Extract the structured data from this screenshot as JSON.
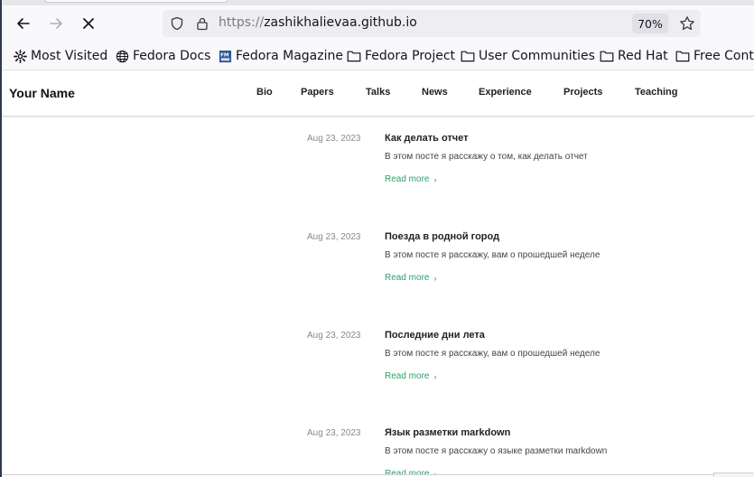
{
  "browser": {
    "url_scheme": "https://",
    "url_host": "zashikhalievaa.github.io",
    "zoom": "70%",
    "icons": [
      "back-icon",
      "forward-icon",
      "stop-icon",
      "shield-icon",
      "lock-icon",
      "star-icon"
    ]
  },
  "bookmarks": [
    {
      "label": "Most Visited",
      "icon": "gear-icon"
    },
    {
      "label": "Fedora Docs",
      "icon": "globe-icon"
    },
    {
      "label": "Fedora Magazine",
      "icon": "fedora-magazine-icon"
    },
    {
      "label": "Fedora Project",
      "icon": "folder-icon"
    },
    {
      "label": "User Communities",
      "icon": "folder-icon"
    },
    {
      "label": "Red Hat",
      "icon": "folder-icon"
    },
    {
      "label": "Free Conte",
      "icon": "folder-icon"
    }
  ],
  "site": {
    "brand": "Your Name",
    "nav": [
      "Bio",
      "Papers",
      "Talks",
      "News",
      "Experience",
      "Projects",
      "Teaching"
    ]
  },
  "posts": [
    {
      "date": "Aug 23, 2023",
      "title": "Как делать отчет",
      "desc": "В этом посте я расскажу о том, как делать отчет",
      "more": "Read more"
    },
    {
      "date": "Aug 23, 2023",
      "title": "Поезда в родной город",
      "desc": "В этом посте я расскажу, вам о прошедшей неделе",
      "more": "Read more"
    },
    {
      "date": "Aug 23, 2023",
      "title": "Последние дни лета",
      "desc": "В этом посте я расскажу, вам о прошедшей неделе",
      "more": "Read more"
    },
    {
      "date": "Aug 23, 2023",
      "title": "Язык разметки markdown",
      "desc": "В этом посте я расскажу о языке разметки markdown",
      "more": "Read more"
    }
  ],
  "colors": {
    "link_green": "#2e9f6a",
    "text": "#222222",
    "muted": "#8a8a8a"
  }
}
